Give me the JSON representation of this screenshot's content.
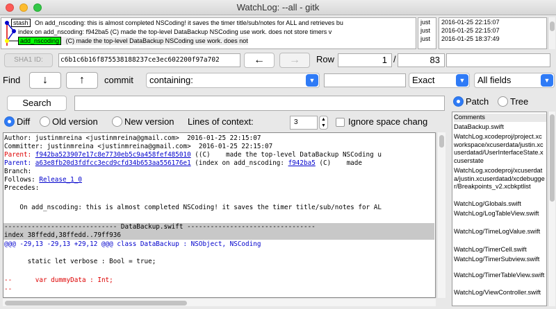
{
  "window": {
    "title": "WatchLog: --all - gitk"
  },
  "graph": {
    "rows": [
      {
        "tag": "stash",
        "text": "On add_nscoding: this is almost completed NSCoding! it saves the timer title/sub/notes for ALL and retrieves bu"
      },
      {
        "tag": "",
        "text": "index on add_nscoding: f942ba5 (C)    made the top-level DataBackup NSCoding use work. does not     store timers v"
      },
      {
        "tag": "add_nscoding",
        "text": "(C)    made the top-level DataBackup NSCoding use work. does not"
      }
    ],
    "authors": [
      "just",
      "just",
      "just"
    ],
    "dates": [
      "2016-01-25 22:15:07",
      "2016-01-25 22:15:07",
      "2016-01-25 18:37:49"
    ]
  },
  "sha": {
    "button_label": "SHA1 ID:",
    "value": "c6b1c6b16f875538188237ce3ec602200f97a702",
    "back_icon": "←",
    "forward_icon": "→",
    "row_label": "Row",
    "row_current": "1",
    "row_sep": "/",
    "row_total": "83"
  },
  "find": {
    "label": "Find",
    "down_icon": "↓",
    "up_icon": "↑",
    "commit_label": "commit",
    "mode": "containing:",
    "match": "Exact",
    "fields": "All fields"
  },
  "search": {
    "button_label": "Search",
    "diff_label": "Diff",
    "old_label": "Old version",
    "new_label": "New version",
    "context_label": "Lines of context:",
    "context_value": "3",
    "ignore_label": "Ignore space chang",
    "patch_label": "Patch",
    "tree_label": "Tree"
  },
  "diff": {
    "author": "Author: justinmreina <justinmreina@gmail.com>  2016-01-25 22:15:07",
    "committer": "Committer: justinmreina <justinmreina@gmail.com>  2016-01-25 22:15:07",
    "parent1_label": "Parent: ",
    "parent1_sha": "f942ba523907e17c8e7730eb5c9a458fef485010",
    "parent1_rest": " ((C)    made the top-level DataBackup NSCoding u",
    "parent2_label": "Parent: ",
    "parent2_sha": "a63e8fb20d3fdfcc3ecd9cfd34b653aa556176e1",
    "parent2_mid": " (index on add_nscoding: ",
    "parent2_link": "f942ba5",
    "parent2_rest": " (C)    made",
    "branch": "Branch:",
    "follows_label": "Follows: ",
    "follows_link": "Release_1_0",
    "precedes": "Precedes:",
    "message": "    On add_nscoding: this is almost completed NSCoding! it saves the timer title/sub/notes for AL",
    "file_header": "----------------------------- DataBackup.swift ---------------------------------",
    "index_line": "index 38ffedd,38ffedd..79ff936",
    "hunk": "@@@ -29,13 -29,13 +29,12 @@@ class DataBackup : NSObject, NSCoding",
    "code1": "      static let verbose : Bool = true;",
    "code2_prefix": "--",
    "code2": "      var dummyData : Int;",
    "code3_prefix": "--"
  },
  "files": [
    "Comments",
    "DataBackup.swift",
    "WatchLog.xcodeproj/project.xcworkspace/xcuserdata/justin.xcuserdatad/UserInterfaceState.xcuserstate",
    "WatchLog.xcodeproj/xcuserdata/justin.xcuserdatad/xcdebugger/Breakpoints_v2.xcbkptlist",
    "WatchLog/Globals.swift",
    "WatchLog/LogTableView.swift",
    "WatchLog/TimeLogValue.swift",
    "WatchLog/TimerCell.swift",
    "WatchLog/TimerSubview.swift",
    "WatchLog/TimerTableView.swift",
    "WatchLog/ViewController.swift"
  ],
  "colors": {
    "accent": "#2f7bf6",
    "branch_tag": "#00ff00",
    "diff_red": "#dd0000",
    "link_blue": "#0000cc"
  }
}
